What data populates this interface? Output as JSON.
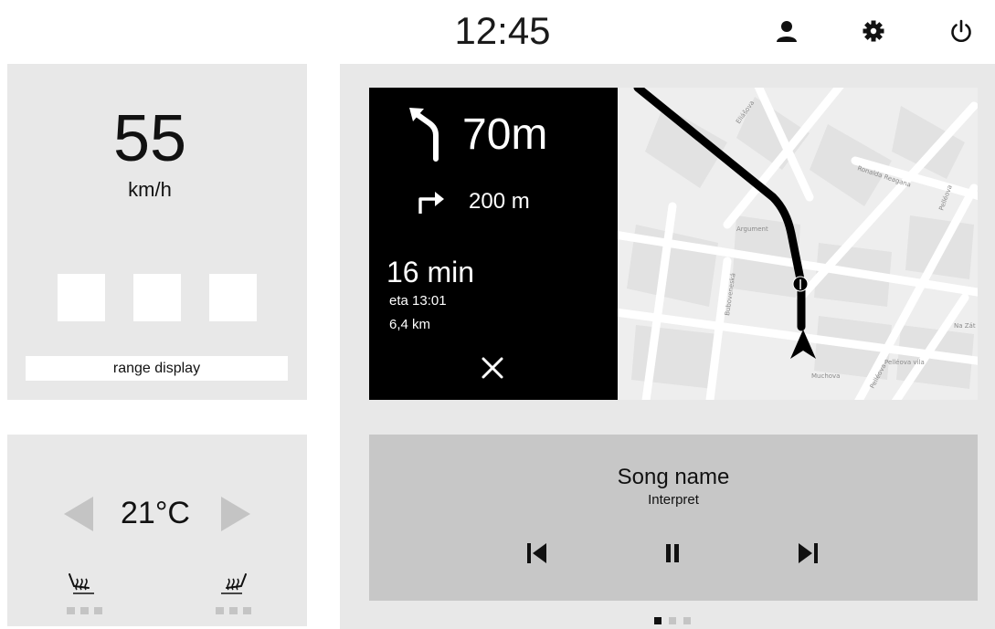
{
  "header": {
    "clock": "12:45",
    "icons": [
      "user-icon",
      "settings-gear-icon",
      "power-icon"
    ]
  },
  "vehicle": {
    "speed": "55",
    "speed_unit": "km/h",
    "range_label": "range display"
  },
  "climate": {
    "temperature": "21°C",
    "seat_heat_left_level": 0,
    "seat_heat_right_level": 0
  },
  "navigation": {
    "next_turn_distance": "70m",
    "following_turn_distance": "200 m",
    "remaining_time": "16 min",
    "eta": "eta 13:01",
    "remaining_distance": "6,4 km",
    "map_labels": [
      "Eliášova",
      "Ronalda Reagana",
      "Pelléova",
      "Argument",
      "Buboveneská",
      "Na Zát",
      "Pelléova vila",
      "Muchova",
      "Pelléova"
    ]
  },
  "media": {
    "song_name": "Song name",
    "interpret": "Interpret"
  },
  "pager": {
    "active_page": 1,
    "page_count": 3
  },
  "colors": {
    "panel_bg": "#e8e8e8",
    "media_bg": "#c7c7c7",
    "nav_bg": "#000000",
    "inactive": "#c4c4c4"
  }
}
